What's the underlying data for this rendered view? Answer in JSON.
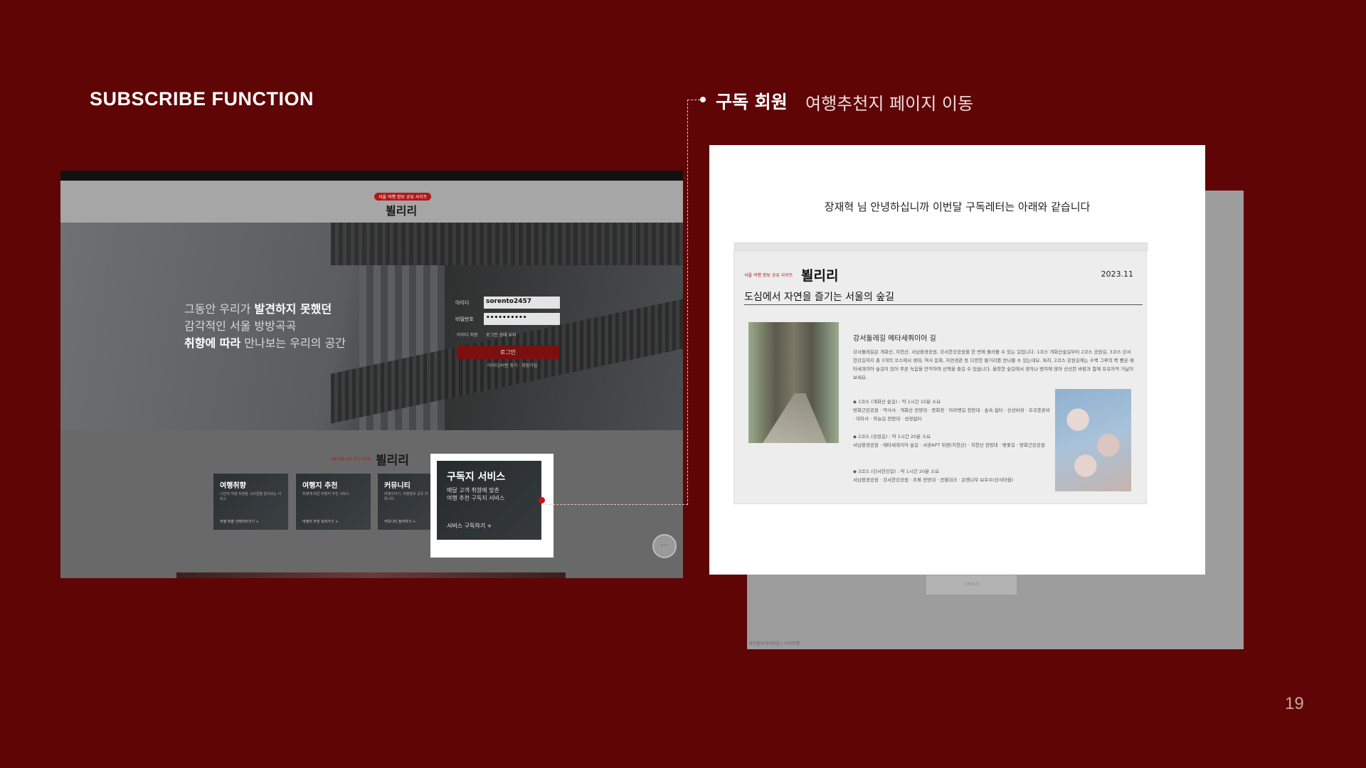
{
  "slide": {
    "title": "SUBSCRIBE FUNCTION",
    "page_number": "19"
  },
  "callout": {
    "title": "구독 회원",
    "subtitle": "여행추천지 페이지 이동"
  },
  "left_screen": {
    "site_badge": "서울 여행 정보 공유 사이트",
    "site_logo": "뵐리리",
    "hero_lines": [
      {
        "pre": "그동안 우리가 ",
        "bold": "발견하지 못했던",
        "post": ""
      },
      {
        "pre": "감각적인 서울 방방곡곡",
        "bold": "",
        "post": ""
      },
      {
        "pre": "",
        "bold": "취향에 따라",
        "post": " 만나보는 우리의 공간"
      }
    ],
    "login": {
      "id_label": "아이디",
      "id_value": "sorento2457",
      "pw_label": "비밀번호",
      "pw_value": "••••••••••",
      "remember_id": "아이디 저장",
      "auto_login": "로그인 상태 유지",
      "button": "로그인",
      "links": "아이디/비번 찾기 · 회원가입"
    },
    "lower_logo": "뵐리리",
    "lower_badge": "서울 여행 정보 공유 사이트",
    "cards": [
      {
        "title": "여행취향",
        "desc": "나만의 여행 취향을 스타일별 알아보는 서비스",
        "link": "여행 취향 선택하러가기 +"
      },
      {
        "title": "여행지 추천",
        "desc": "취향에 따른 여행지 추천 서비스",
        "link": "여행지 추천 보러가기 +"
      },
      {
        "title": "커뮤니티",
        "desc": "여행이야기, 여행정보 공유 커뮤니티",
        "link": "커뮤니티 참여하기 +"
      }
    ],
    "subscribe_card": {
      "title": "구독지 서비스",
      "desc_line1": "매달 고객 취향에 맞춘",
      "desc_line2": "여행 추천 구독지 서비스",
      "link": "서비스 구독하기 +"
    },
    "chat_icon_label": "···"
  },
  "right_screen": {
    "greeting": "장재혁 님 안녕하십니까 이번달 구독레터는 아래와 같습니다",
    "newsletter": {
      "badge": "서울 여행 정보 공유 사이트",
      "logo": "뵐리리",
      "date": "2023.11",
      "title": "도심에서 자연을 즐기는 서울의 숲길",
      "subhead": "강서둘레길 메타세쿼이어 길",
      "body": "강서둘레길은 개화산, 치현산, 서남환경공원, 강서한강공원을 한 번에 둘러볼 수 있는 길입니다. 1코스 개화산숲길부터 2코스 공원길, 3코스 강서한강길까지 총 3개의 코스에서 생태, 역사 문화, 자연경관 등 다양한 볼거리를 만나볼 수 있는데요. 특히, 2코스 공원길에는 수백 그루의 쭉 뻗은 메타세쿼이아 숲길이 있어 푸른 녹음을 만끽하며 산책을 즐길 수 있습니다. 울창한 숲길에서 경자나 벤치에 앉아 선선한 바람과 함께 유유자적 거닐어 보세요.",
      "courses": [
        {
          "head": "◆ 1코스 (개화산 숲길) : 약 1시간 10분 소요",
          "detail": "방화근린공원 · 약사사 · 개화산 전망대 · 봉화정 · 아라뱃길 전망대 · 숲속 쉼터 · 신선바위 · 호국충혼비 · 미타사 · 하늘길 전망대 · 성경쉼터"
        },
        {
          "head": "◆ 2코스 (공원길) : 약 1시간 20분 소요",
          "detail": "서남환경공원 · 메타세쿼이아 숲길 · 서광APT 뒤편(치현산) · 치현산 전망대 · 벚꽃길 · 방화근린공원"
        },
        {
          "head": "◆ 3코스 (강서한강길) : 약 1시간 20분 소요",
          "detail": "서남환경공원 · 강서한강공원 · 조류 전망대 · 전월대크 · 은행나무 보호수(상사마을)"
        }
      ]
    },
    "back_button": "구독하기",
    "back_footer": "개인정보처리방침 | 사이트맵"
  }
}
